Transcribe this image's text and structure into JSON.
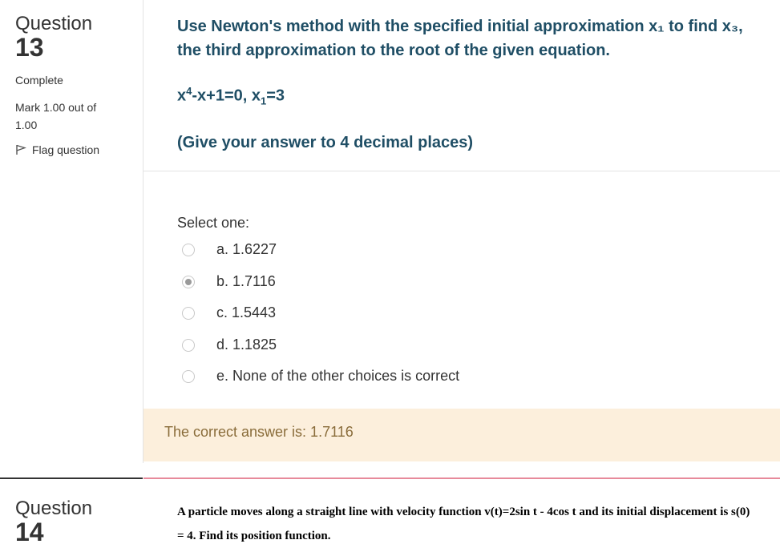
{
  "q13": {
    "label": "Question",
    "number": "13",
    "state": "Complete",
    "grade": "Mark 1.00 out of 1.00",
    "flag_label": "Flag question",
    "text": "Use Newton's method with the specified initial approximation x₁ to find x₃, the third approximation to the root of the given equation.",
    "equation": {
      "part1": "x",
      "exp": "4",
      "part2": "-x+1=0, x",
      "sub": "1",
      "part3": "=3"
    },
    "hint": "(Give your answer to 4 decimal places)",
    "select_one": "Select one:",
    "options": [
      {
        "label": "a. 1.6227",
        "checked": false
      },
      {
        "label": "b. 1.7116",
        "checked": true
      },
      {
        "label": "c. 1.5443",
        "checked": false
      },
      {
        "label": "d. 1.1825",
        "checked": false
      },
      {
        "label": "e. None of the other choices is correct",
        "checked": false
      }
    ],
    "feedback": "The correct answer is: 1.7116"
  },
  "q14": {
    "label": "Question",
    "number": "14",
    "text": "A particle moves along a straight line with velocity function v(t)=2sin t - 4cos t and its initial displacement is s(0) = 4. Find its position function."
  },
  "colors": {
    "question_text": "#1f4e65",
    "feedback_bg": "#fcefdc",
    "feedback_text": "#8a6d3b"
  }
}
